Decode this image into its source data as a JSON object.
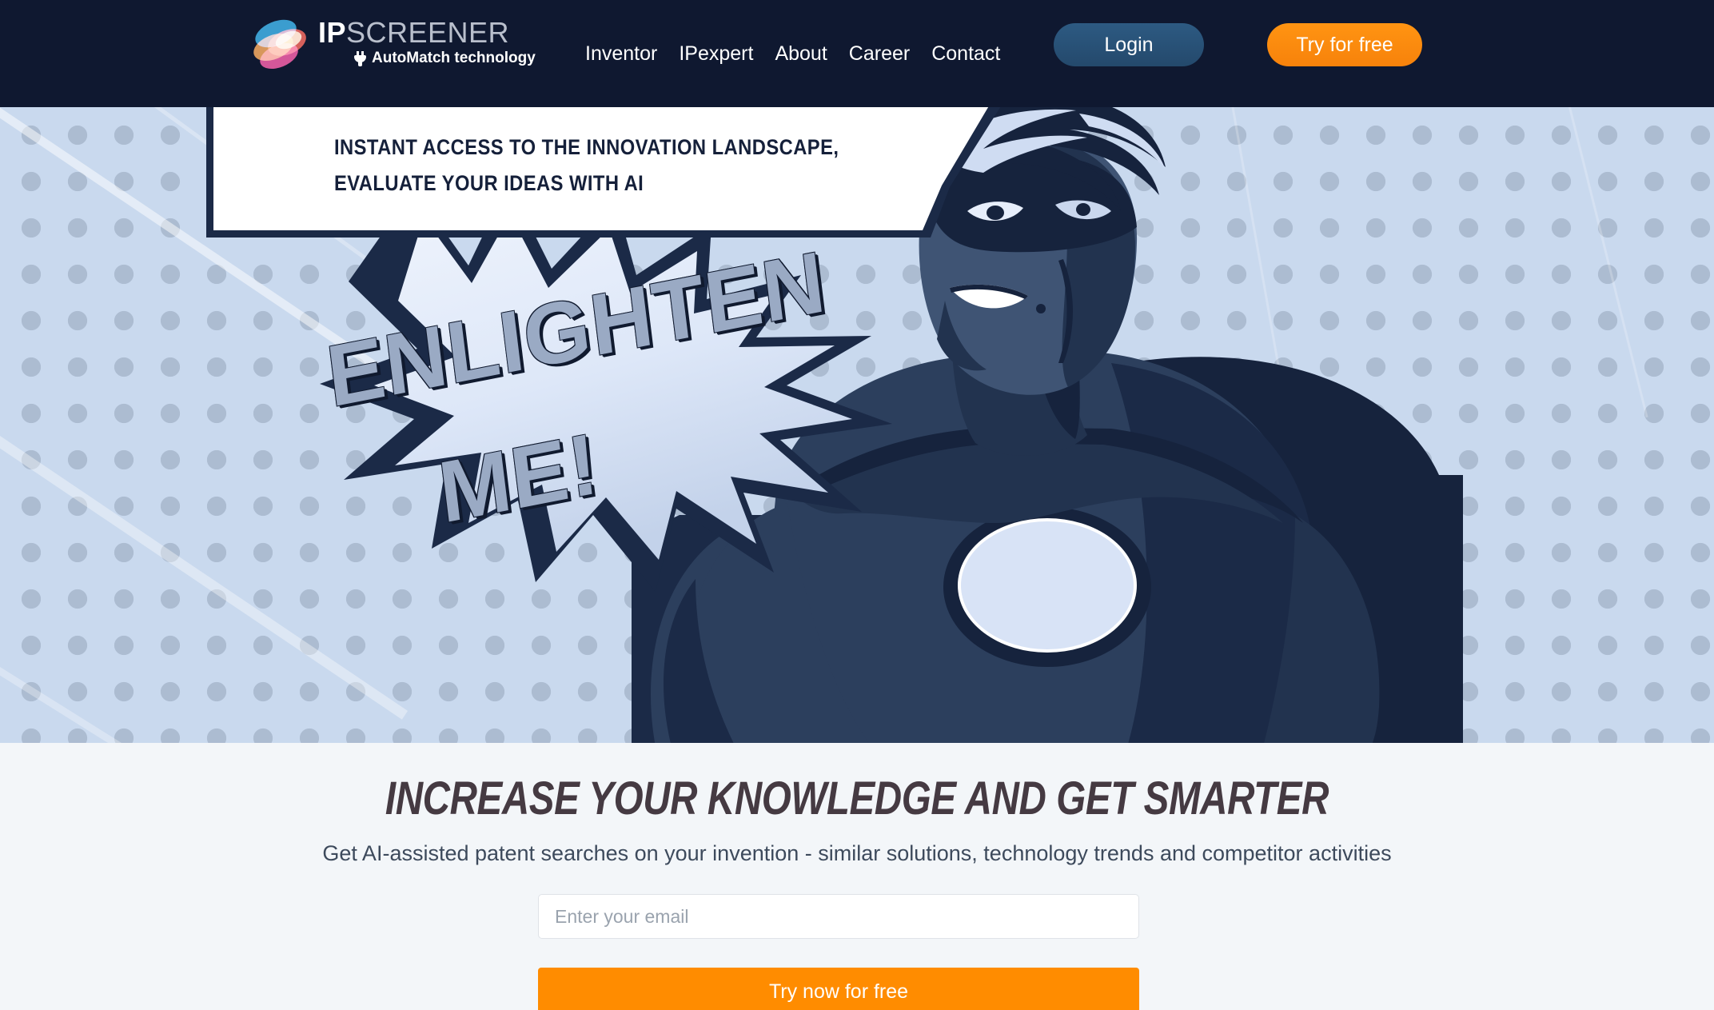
{
  "header": {
    "logo": {
      "name_bold": "IP",
      "name_light": "SCREENER",
      "tagline": "AutoMatch technology"
    },
    "nav": [
      {
        "label": "Inventor"
      },
      {
        "label": "IPexpert"
      },
      {
        "label": "About"
      },
      {
        "label": "Career"
      },
      {
        "label": "Contact"
      }
    ],
    "login_label": "Login",
    "try_label": "Try for free",
    "colors": {
      "background": "#0f1830",
      "login_button": "#2d5a82",
      "try_button": "#ff9412",
      "nav_text": "#ffffff"
    }
  },
  "hero": {
    "speech_line_1": "INSTANT ACCESS TO THE INNOVATION LANDSCAPE,",
    "speech_line_2": "EVALUATE YOUR IDEAS WITH AI",
    "burst_line_1": "ENLIGHTEN",
    "burst_line_2": "ME!",
    "colors": {
      "background": "#c9d9ee",
      "dots": "#acbcd1",
      "ink": "#1b2a47",
      "burst_fill": "#e3ebf8",
      "burst_text": "#9aaac4"
    }
  },
  "lower": {
    "title": "INCREASE YOUR KNOWLEDGE AND GET SMARTER",
    "subtitle": "Get AI-assisted patent searches on your invention - similar solutions, technology trends and competitor activities",
    "email_placeholder": "Enter your email",
    "email_value": "",
    "cta_label": "Try now for free",
    "colors": {
      "background": "#f3f6f9",
      "title": "#453a42",
      "cta": "#ff8c00"
    }
  }
}
